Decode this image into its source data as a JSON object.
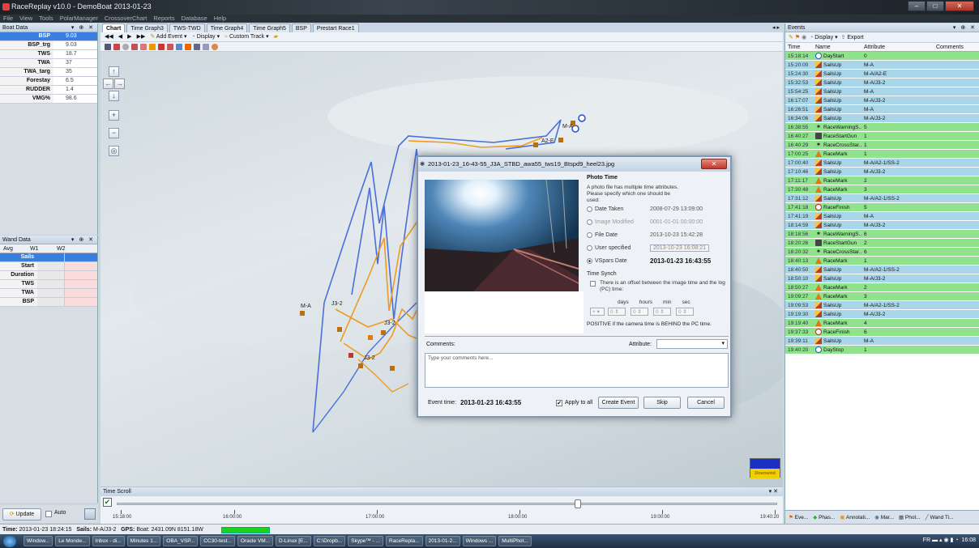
{
  "app": {
    "title": "RaceReplay v10.0 - DemoBoat 2013-01-23",
    "menu": [
      "File",
      "View",
      "Tools",
      "PolarManager",
      "CrossoverChart",
      "Reports",
      "Database",
      "Help"
    ]
  },
  "boat_data": {
    "title": "Boat Data",
    "rows": [
      {
        "name": "BSP",
        "value": "9.03"
      },
      {
        "name": "BSP_trg",
        "value": "9.03"
      },
      {
        "name": "TWS",
        "value": "18.7"
      },
      {
        "name": "TWA",
        "value": "37"
      },
      {
        "name": "TWA_targ",
        "value": "35"
      },
      {
        "name": "Forestay",
        "value": "6.5"
      },
      {
        "name": "RUDDER",
        "value": "1.4"
      },
      {
        "name": "VMG%",
        "value": "98.6"
      }
    ]
  },
  "wand_data": {
    "title": "Wand Data",
    "columns": [
      "Avg",
      "W1",
      "W2"
    ],
    "rows": [
      "Sails",
      "Start",
      "Duration",
      "TWS",
      "TWA",
      "BSP"
    ]
  },
  "bottom_left": {
    "update": "Update",
    "auto": "Auto"
  },
  "status": {
    "time_label": "Time:",
    "time": "2013-01-23 18:24:15",
    "sails_label": "Sails:",
    "sails": "M-A/J3-2",
    "gps_label": "GPS:",
    "gps": "Boat: 2431.09N 8151.18W"
  },
  "tabs": [
    "Chart",
    "Time Graph3",
    "TWS-TWD",
    "Time Graph4",
    "Time Graph5",
    "BSP",
    "Prestart Race1"
  ],
  "toolbar": {
    "add_event": "Add Event ▾",
    "display": "Display ▾",
    "custom_track": "Custom Track ▾"
  },
  "chart": {
    "downwind": "Downwind"
  },
  "labels": {
    "ma1": "M-A",
    "ma2": "M-A",
    "a2": "A2-E",
    "j32": "J3-2",
    "j32b": "J3-2",
    "j32c": "J3-2"
  },
  "time_scroll": {
    "title": "Time Scroll",
    "ticks": [
      "15:18:00",
      "16:00:00",
      "17:00:00",
      "18:00:00",
      "19:00:00",
      "19:40:20"
    ]
  },
  "events": {
    "title": "Events",
    "toolbar": {
      "display": "Display ▾",
      "export": "Export"
    },
    "columns": [
      "Time",
      "Name",
      "Attribute",
      "Comments"
    ],
    "rows": [
      {
        "time": "15:18:14",
        "name": "DayStart",
        "attr": "0",
        "color": "green",
        "icon": "start"
      },
      {
        "time": "15:20:00",
        "name": "SailsUp",
        "attr": "M-A",
        "color": "blue",
        "icon": "sail"
      },
      {
        "time": "15:24:30",
        "name": "SailsUp",
        "attr": "M-A/A2-E",
        "color": "blue",
        "icon": "sail"
      },
      {
        "time": "15:32:53",
        "name": "SailsUp",
        "attr": "M-A/J3-2",
        "color": "blue",
        "icon": "sail"
      },
      {
        "time": "15:54:25",
        "name": "SailsUp",
        "attr": "M-A",
        "color": "blue",
        "icon": "sail"
      },
      {
        "time": "16:17:07",
        "name": "SailsUp",
        "attr": "M-A/J3-2",
        "color": "blue",
        "icon": "sail"
      },
      {
        "time": "16:26:51",
        "name": "SailsUp",
        "attr": "M-A",
        "color": "blue",
        "icon": "sail"
      },
      {
        "time": "16:34:06",
        "name": "SailsUp",
        "attr": "M-A/J3-2",
        "color": "blue",
        "icon": "sail"
      },
      {
        "time": "16:38:55",
        "name": "RaceWarningS...",
        "attr": "5",
        "color": "green",
        "icon": "warn"
      },
      {
        "time": "16:40:27",
        "name": "RaceStartGun",
        "attr": "1",
        "color": "green",
        "icon": "gun"
      },
      {
        "time": "16:40:29",
        "name": "RaceCrossStar...",
        "attr": "1",
        "color": "green",
        "icon": "warn"
      },
      {
        "time": "17:00:25",
        "name": "RaceMark",
        "attr": "1",
        "color": "green",
        "icon": "mark"
      },
      {
        "time": "17:00:40",
        "name": "SailsUp",
        "attr": "M-A/A2-1/SS-2",
        "color": "blue",
        "icon": "sail"
      },
      {
        "time": "17:10:46",
        "name": "SailsUp",
        "attr": "M-A/J3-2",
        "color": "blue",
        "icon": "sail"
      },
      {
        "time": "17:11:17",
        "name": "RaceMark",
        "attr": "2",
        "color": "green",
        "icon": "mark"
      },
      {
        "time": "17:30:48",
        "name": "RaceMark",
        "attr": "3",
        "color": "green",
        "icon": "mark"
      },
      {
        "time": "17:31:12",
        "name": "SailsUp",
        "attr": "M-A/A2-1/SS-2",
        "color": "blue",
        "icon": "sail"
      },
      {
        "time": "17:41:18",
        "name": "RaceFinish",
        "attr": "5",
        "color": "green",
        "icon": "finish"
      },
      {
        "time": "17:41:19",
        "name": "SailsUp",
        "attr": "M-A",
        "color": "blue",
        "icon": "sail"
      },
      {
        "time": "18:14:59",
        "name": "SailsUp",
        "attr": "M-A/J3-2",
        "color": "blue",
        "icon": "sail"
      },
      {
        "time": "18:18:56",
        "name": "RaceWarningS...",
        "attr": "6",
        "color": "green",
        "icon": "warn"
      },
      {
        "time": "18:20:26",
        "name": "RaceStartGun",
        "attr": "2",
        "color": "green",
        "icon": "gun"
      },
      {
        "time": "18:20:32",
        "name": "RaceCrossStar...",
        "attr": "6",
        "color": "green",
        "icon": "warn"
      },
      {
        "time": "18:40:13",
        "name": "RaceMark",
        "attr": "1",
        "color": "green",
        "icon": "mark"
      },
      {
        "time": "18:40:50",
        "name": "SailsUp",
        "attr": "M-A/A2-1/SS-2",
        "color": "blue",
        "icon": "sail"
      },
      {
        "time": "18:50:10",
        "name": "SailsUp",
        "attr": "M-A/J3-2",
        "color": "blue",
        "icon": "sail"
      },
      {
        "time": "18:50:27",
        "name": "RaceMark",
        "attr": "2",
        "color": "green",
        "icon": "mark"
      },
      {
        "time": "19:09:27",
        "name": "RaceMark",
        "attr": "3",
        "color": "green",
        "icon": "mark"
      },
      {
        "time": "19:09:53",
        "name": "SailsUp",
        "attr": "M-A/A2-1/SS-2",
        "color": "blue",
        "icon": "sail"
      },
      {
        "time": "19:19:30",
        "name": "SailsUp",
        "attr": "M-A/J3-2",
        "color": "blue",
        "icon": "sail"
      },
      {
        "time": "19:19:40",
        "name": "RaceMark",
        "attr": "4",
        "color": "green",
        "icon": "mark"
      },
      {
        "time": "19:37:33",
        "name": "RaceFinish",
        "attr": "6",
        "color": "green",
        "icon": "finish"
      },
      {
        "time": "19:39:11",
        "name": "SailsUp",
        "attr": "M-A",
        "color": "blue",
        "icon": "sail"
      },
      {
        "time": "19:40:20",
        "name": "DayStop",
        "attr": "1",
        "color": "green",
        "icon": "start"
      }
    ],
    "bottom_tabs": [
      "Eve...",
      "Phas...",
      "Annotati...",
      "Mar...",
      "Phot...",
      "Wand Ti..."
    ]
  },
  "dialog": {
    "title": "2013-01-23_16-43-55_J3A_STBD_awa55_tws19_Btspd9_heel23.jpg",
    "photo_time": "Photo Time",
    "instructions": "A photo file has multiple time attributes. Please specify which one should be used:",
    "options": [
      {
        "label": "Date Taken",
        "value": "2008-07-29 13:09:00"
      },
      {
        "label": "Image Modified",
        "value": "0001-01-01 00:00:00"
      },
      {
        "label": "File Date",
        "value": "2013-10-23 15:42:28"
      },
      {
        "label": "User specified",
        "value": "2013-10-23 16:08:21"
      },
      {
        "label": "VSpars Date",
        "value": "2013-01-23 16:43:55"
      }
    ],
    "time_synch": "Time Synch",
    "offset_text": "There is an offset between the image time and the log (PC) time:",
    "units": [
      "days",
      "hours",
      "min",
      "sec"
    ],
    "positive_note": "POSITIVE if the camera time is BEHIND the PC time.",
    "comments_label": "Comments:",
    "attribute_label": "Attribute:",
    "comments_placeholder": "Type your comments here...",
    "event_time_label": "Event time:",
    "event_time": "2013-01-23 16:43:55",
    "apply_all": "Apply to all",
    "create_event": "Create Event",
    "skip": "Skip",
    "cancel": "Cancel"
  },
  "taskbar": {
    "items": [
      "Window...",
      "Le Monde...",
      "Inbox - di...",
      "Minutes 1...",
      "OBA_VSP...",
      "CC30-test...",
      "Oracle VM...",
      "D-Linux [E...",
      "C:\\Dropb...",
      "Skype™ - ...",
      "RaceRepla...",
      "2013-01-2...",
      "Windows ...",
      "MultiPhot..."
    ],
    "lang": "FR",
    "clock": "16:08"
  }
}
